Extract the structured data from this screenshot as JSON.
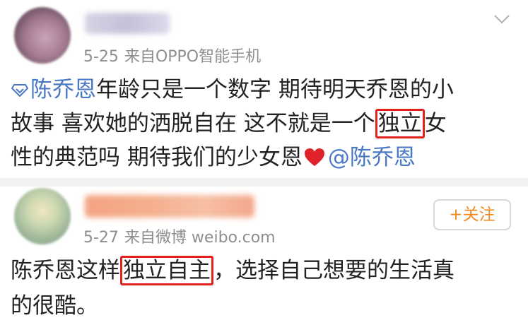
{
  "post1": {
    "date": "5-25",
    "source": "来自OPPO智能手机",
    "topic": "陈乔恩",
    "text_a": "年龄只是一个数字 期待明天乔恩的小",
    "text_b": "故事 喜欢她的洒脱自在 这不就是一个",
    "highlight": "独立",
    "text_c": "女",
    "text_d": "性的典范吗 期待我们的少女恩",
    "mention": "@陈乔恩"
  },
  "post2": {
    "date": "5-27",
    "source": "来自微博 weibo.com",
    "follow_label": "+关注",
    "text_a": "陈乔恩这样",
    "highlight": "独立自主",
    "text_b": "，选择自己想要的生活真",
    "text_c": "的很酷。"
  },
  "colors": {
    "link": "#4978c5",
    "highlight_box": "#e3201c",
    "follow": "#f28a22",
    "meta": "#8e8e8e"
  },
  "icons": [
    "chevron-down-icon",
    "topic-icon",
    "heart-icon"
  ]
}
